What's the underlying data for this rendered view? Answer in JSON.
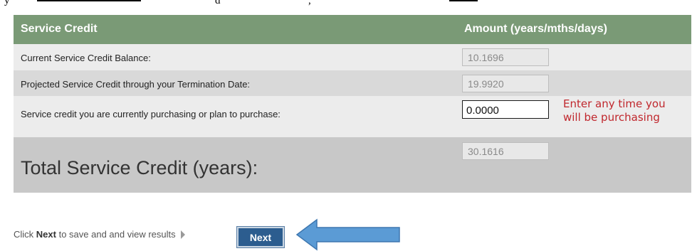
{
  "top_strip": {
    "fragment_left": "y",
    "fragment_mid": "d",
    "fragment_right": ","
  },
  "table": {
    "header_label": "Service Credit",
    "header_amount": "Amount (years/mths/days)",
    "rows": [
      {
        "label": "Current Service Credit Balance:",
        "value": "10.1696"
      },
      {
        "label": "Projected Service Credit through your Termination Date:",
        "value": "19.9920"
      },
      {
        "label": "Service credit you are currently purchasing or plan to purchase:",
        "value": "0.0000"
      }
    ],
    "total_label": "Total Service Credit (years):",
    "total_value": "30.1616"
  },
  "annotation": {
    "text": "Enter any time you will be purchasing",
    "color": "#c0272d"
  },
  "footer": {
    "prefix": "Click ",
    "bold": "Next",
    "suffix": " to save and and view results",
    "next_label": "Next",
    "arrow_color": "#5b9bd5"
  },
  "colors": {
    "header_bg": "#7a9a76",
    "button_bg": "#2c5d8f"
  }
}
